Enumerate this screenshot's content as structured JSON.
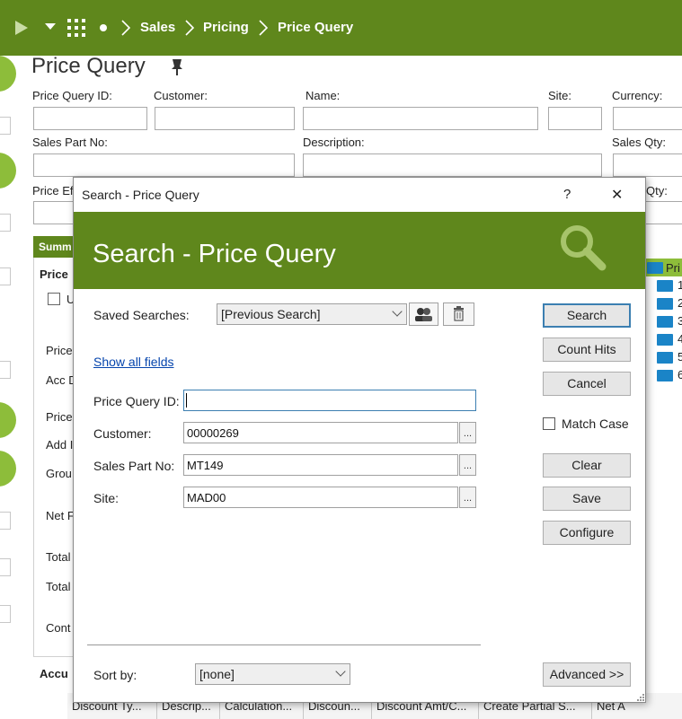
{
  "breadcrumb": {
    "items": [
      "Sales",
      "Pricing",
      "Price Query"
    ]
  },
  "page": {
    "title": "Price Query",
    "labels": {
      "price_query_id": "Price Query ID:",
      "customer": "Customer:",
      "name": "Name:",
      "site": "Site:",
      "currency": "Currency:",
      "sales_part_no": "Sales Part No:",
      "description": "Description:",
      "sales_qty": "Sales Qty:",
      "price_eff": "Price Ef",
      "qty_partial": "Qty:"
    },
    "summary_tab": "Summ",
    "left_labels": [
      "Price",
      "U",
      "Price",
      "Acc D",
      "Price",
      "Add I",
      "Grou",
      "Net F",
      "Total",
      "Total",
      "Cont",
      "Accu"
    ],
    "tree_label": "Pri",
    "tree_numbers": [
      "1",
      "2",
      "3",
      "4",
      "5",
      "6"
    ]
  },
  "grid": {
    "columns": [
      "Discount Ty...",
      "Descrip...",
      "Calculation...",
      "Discoun...",
      "Discount Amt/C...",
      "Create Partial S...",
      "Net A"
    ]
  },
  "dialog": {
    "window_title": "Search - Price Query",
    "help_glyph": "?",
    "close_glyph": "✕",
    "header_title": "Search - Price Query",
    "saved_searches_label": "Saved Searches:",
    "saved_searches_value": "[Previous Search]",
    "show_all_fields": "Show all fields",
    "fields": {
      "price_query_id": {
        "label": "Price Query ID:",
        "value": ""
      },
      "customer": {
        "label": "Customer:",
        "value": "00000269"
      },
      "sales_part_no": {
        "label": "Sales Part No:",
        "value": "MT149"
      },
      "site": {
        "label": "Site:",
        "value": "MAD00"
      }
    },
    "ellipsis": "...",
    "buttons": {
      "search": "Search",
      "count_hits": "Count Hits",
      "cancel": "Cancel",
      "clear": "Clear",
      "save": "Save",
      "configure": "Configure",
      "advanced": "Advanced >>"
    },
    "match_case": "Match Case",
    "sort_by_label": "Sort by:",
    "sort_by_value": "[none]"
  },
  "colors": {
    "brand_green": "#5f871c",
    "accent_green": "#8dbd3a",
    "folder_blue": "#1a84c7",
    "link_blue": "#0645ad"
  }
}
